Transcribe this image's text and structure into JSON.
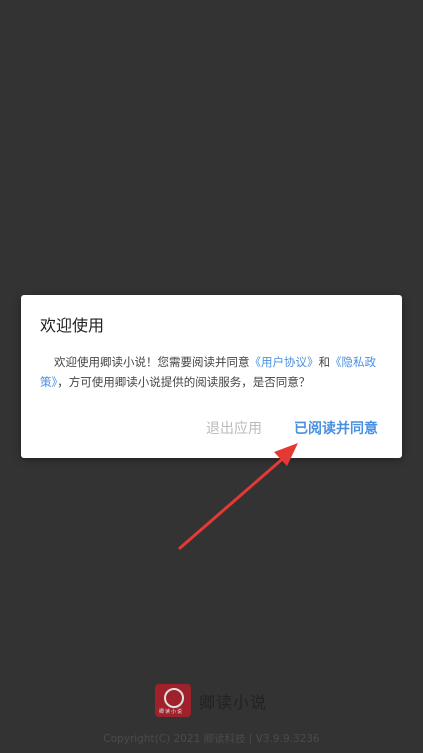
{
  "dialog": {
    "title": "欢迎使用",
    "body_prefix": "欢迎使用卿读小说！您需要阅读并同意",
    "link_user_agreement": "《用户协议》",
    "body_and": "和",
    "link_privacy_policy": "《隐私政策》",
    "body_suffix": "，方可使用卿读小说提供的阅读服务，是否同意？",
    "exit_label": "退出应用",
    "agree_label": "已阅读并同意"
  },
  "footer": {
    "app_name": "卿读小说",
    "logo_text": "卿读小说",
    "copyright": "Copyright(C) 2021 卿读科技 | V3.9.9.3236"
  },
  "colors": {
    "background": "#333333",
    "link": "#4a90e2",
    "arrow": "#e53935"
  },
  "icons": {
    "logo": "app-logo-icon",
    "arrow": "red-pointer-arrow-icon"
  }
}
